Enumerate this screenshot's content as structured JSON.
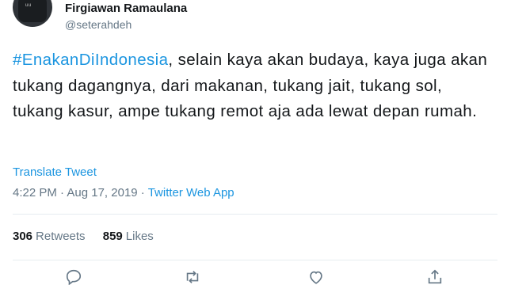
{
  "author": {
    "name": "Firgiawan Ramaulana",
    "handle": "@seterahdeh",
    "avatar_text": "uu"
  },
  "tweet": {
    "hashtag": "#EnakanDiIndonesia",
    "text": ", selain kaya akan budaya, kaya juga akan tukang dagangnya, dari makanan, tukang jait, tukang sol, tukang kasur, ampe tukang remot aja ada lewat depan rumah."
  },
  "translate_label": "Translate Tweet",
  "meta": {
    "time": "4:22 PM",
    "separator": " · ",
    "date": "Aug 17, 2019",
    "source": "Twitter Web App"
  },
  "stats": {
    "retweets_count": "306",
    "retweets_label": "Retweets",
    "likes_count": "859",
    "likes_label": "Likes"
  },
  "colors": {
    "link": "#1b95e0",
    "secondary_text": "#657786",
    "primary_text": "#14171a",
    "divider": "#e6ecf0"
  },
  "icons": [
    "reply-icon",
    "retweet-icon",
    "like-icon",
    "share-icon"
  ]
}
